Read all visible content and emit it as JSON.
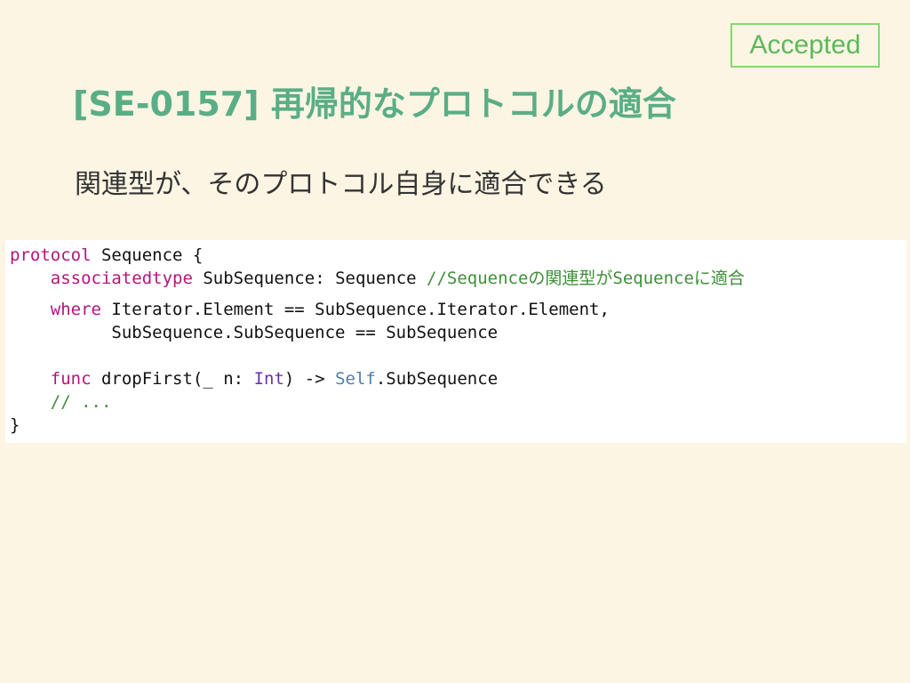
{
  "badge": {
    "label": "Accepted"
  },
  "title": "[SE-0157] 再帰的なプロトコルの適合",
  "subtitle": "関連型が、そのプロトコル自身に適合できる",
  "code": {
    "l1": {
      "kw": "protocol",
      "rest": " Sequence {"
    },
    "l2": {
      "indent": "    ",
      "kw": "associatedtype",
      "rest": " SubSequence: Sequence ",
      "comment": "//Sequenceの関連型がSequenceに適合"
    },
    "l3": {
      "indent": "    ",
      "kw": "where",
      "rest": " Iterator.Element == SubSequence.Iterator.Element,"
    },
    "l4": {
      "text": "          SubSequence.SubSequence == SubSequence"
    },
    "l5": {
      "indent": "    ",
      "kw": "func",
      "mid": " dropFirst(_ n: ",
      "type": "Int",
      "arrow": ") -> ",
      "self": "Self",
      "tail": ".SubSequence"
    },
    "l6": {
      "indent": "    ",
      "comment": "// ..."
    },
    "l7": {
      "text": "}"
    }
  }
}
